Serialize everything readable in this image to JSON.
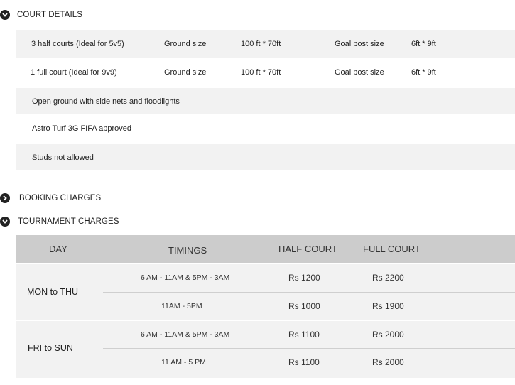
{
  "court_details": {
    "title": "COURT DETAILS",
    "icon": "chevron-down-circle-icon",
    "courts": [
      {
        "name": "3 half courts (Ideal for 5v5)",
        "ground_label": "Ground size",
        "ground_value": "100 ft * 70ft",
        "goal_label": "Goal post size",
        "goal_value": "6ft * 9ft"
      },
      {
        "name": "1 full court (Ideal for 9v9)",
        "ground_label": "Ground size",
        "ground_value": "100 ft * 70ft",
        "goal_label": "Goal post size",
        "goal_value": "6ft * 9ft"
      }
    ],
    "features": [
      "Open ground with side nets and floodlights",
      "Astro Turf 3G FIFA approved",
      "Studs not allowed"
    ]
  },
  "booking_charges": {
    "title": "BOOKING CHARGES",
    "icon": "chevron-right-circle-icon"
  },
  "tournament_charges": {
    "title": "TOURNAMENT CHARGES",
    "icon": "chevron-down-circle-icon",
    "headers": {
      "day": "DAY",
      "timings": "TIMINGS",
      "half": "HALF COURT",
      "full": "FULL COURT"
    },
    "groups": [
      {
        "day": "MON to THU",
        "rows": [
          {
            "timing": "6 AM - 11AM  &  5PM - 3AM",
            "half": "Rs 1200",
            "full": "Rs 2200"
          },
          {
            "timing": "11AM -  5PM",
            "half": "Rs 1000",
            "full": "Rs 1900"
          }
        ]
      },
      {
        "day": "FRI to SUN",
        "rows": [
          {
            "timing": "6 AM - 11AM  &  5PM - 3AM",
            "half": "Rs 1100",
            "full": "Rs 2000"
          },
          {
            "timing": "11 AM - 5 PM",
            "half": "Rs 1100",
            "full": "Rs 2000"
          }
        ]
      }
    ]
  },
  "colors": {
    "row_shade": "#f2f2f2",
    "header_bg": "#cccccc",
    "icon": "#222222"
  }
}
